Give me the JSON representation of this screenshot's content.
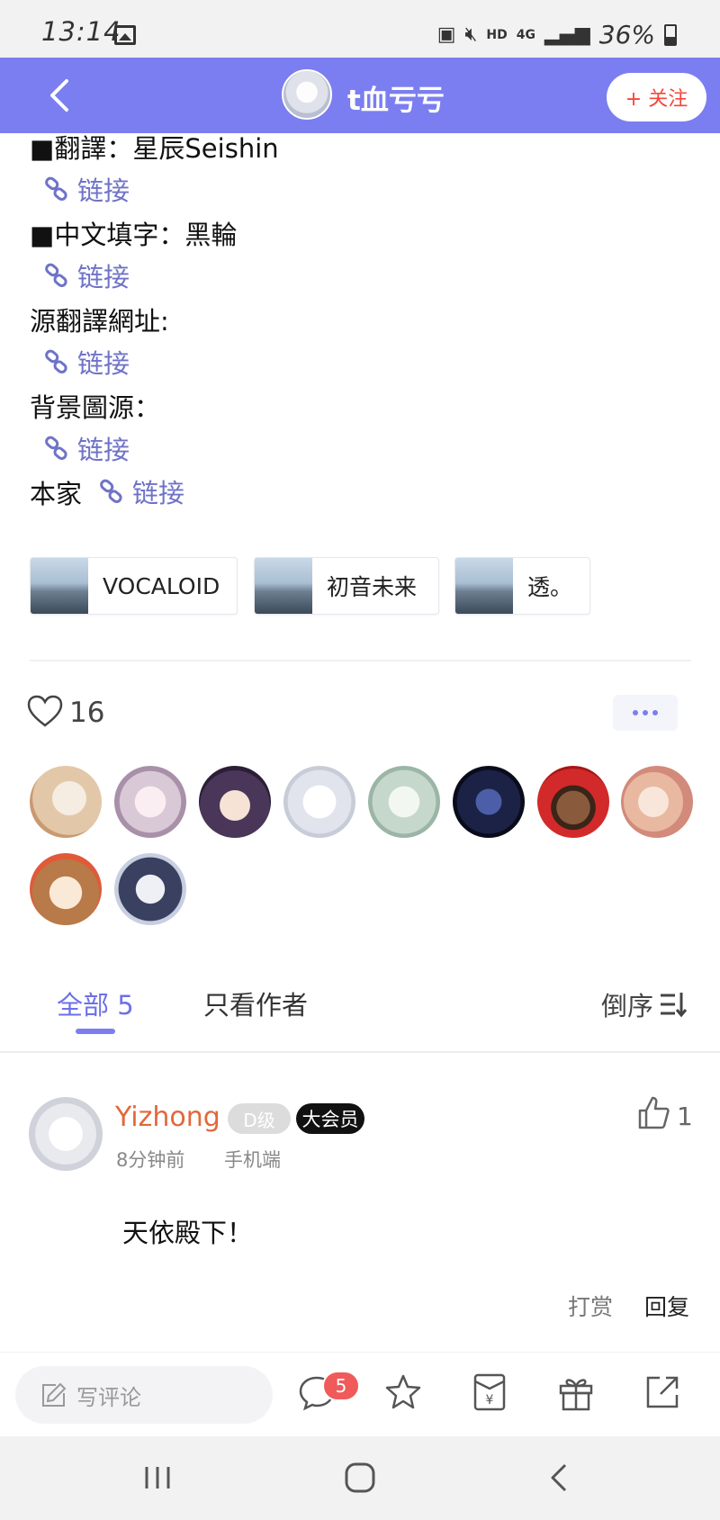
{
  "status_bar": {
    "time": "13:14",
    "hd": "HD",
    "network": "4G",
    "battery": "36%"
  },
  "nav": {
    "title": "t血亏亏",
    "follow_label": "+ 关注"
  },
  "content": {
    "lines": [
      {
        "text": "■翻譯：星辰Seishin"
      },
      {
        "text": "■中文填字：黑輪"
      },
      {
        "text": "源翻譯網址:"
      },
      {
        "text": "背景圖源："
      },
      {
        "text": "本家"
      }
    ],
    "link_label": "链接"
  },
  "tags": [
    {
      "label": "VOCALOID"
    },
    {
      "label": "初音未来"
    },
    {
      "label": "透。"
    }
  ],
  "likes": {
    "count": "16"
  },
  "tabs": {
    "all": "全部 5",
    "author_only": "只看作者",
    "sort": "倒序"
  },
  "comment": {
    "user": "Yizhong",
    "level": "D级",
    "vip": "大会员",
    "time": "8分钟前",
    "device": "手机端",
    "likes": "1",
    "text": "天依殿下！",
    "tip": "打赏",
    "reply": "回复"
  },
  "toolbar": {
    "comment_placeholder": "写评论",
    "comment_badge": "5"
  },
  "colors": {
    "accent": "#7b7ef0",
    "link": "#6f73c7",
    "username": "#e2683a",
    "follow": "#f4463a",
    "badge": "#f05a5a"
  }
}
